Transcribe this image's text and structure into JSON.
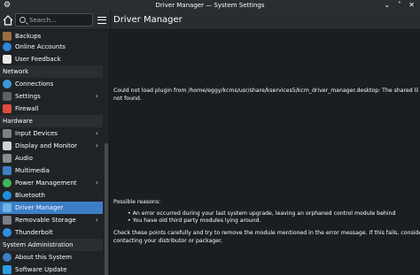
{
  "window": {
    "title": "Driver Manager — System Settings",
    "controls": "⌄ ˄ ✕"
  },
  "search": {
    "placeholder": "Search..."
  },
  "sidebar": {
    "items_top": [
      {
        "label": "Backups",
        "color": "#9a6d3e"
      },
      {
        "label": "Online Accounts",
        "color": "#2c87d8"
      },
      {
        "label": "User Feedback",
        "color": "#e9e9e9"
      }
    ],
    "section_network": "Network",
    "network_items": [
      {
        "label": "Connections",
        "color": "#3a9ad9"
      },
      {
        "label": "Settings",
        "color": "#5c6166",
        "chevron": "›"
      },
      {
        "label": "Firewall",
        "color": "#e04b3a"
      }
    ],
    "section_hardware": "Hardware",
    "hardware_items": [
      {
        "label": "Input Devices",
        "color": "#7a8087",
        "chevron": "›"
      },
      {
        "label": "Display and Monitor",
        "color": "#cfd2d5",
        "chevron": "›"
      },
      {
        "label": "Audio",
        "color": "#888d92"
      },
      {
        "label": "Multimedia",
        "color": "#3d7ec6"
      },
      {
        "label": "Power Management",
        "color": "#3fb75a",
        "chevron": "›"
      },
      {
        "label": "Bluetooth",
        "color": "#1d8fe0"
      },
      {
        "label": "Driver Manager",
        "color": "#6bb6e8",
        "selected": true
      },
      {
        "label": "Removable Storage",
        "color": "#7a8087",
        "chevron": "›"
      },
      {
        "label": "Thunderbolt",
        "color": "#2f8fe0"
      }
    ],
    "section_sysadmin": "System Administration",
    "sysadmin_items": [
      {
        "label": "About this System",
        "color": "#3d7ec6"
      },
      {
        "label": "Software Update",
        "color": "#2c9be0"
      }
    ]
  },
  "page": {
    "title": "Driver Manager",
    "error_message": "Could not load plugin from /home/eggy/kcms/usr/share/kservices5/kcm_driver_manager.desktop: The shared library was\nnot found.",
    "reasons_title": "Possible reasons:",
    "reasons": [
      "• An error occurred during your last system upgrade, leaving an orphaned control module behind",
      "• You have old third party modules lying around."
    ],
    "advice": "Check these points carefully and try to remove the module mentioned in the error message. If this fails, consider\ncontacting your distributor or packager."
  }
}
